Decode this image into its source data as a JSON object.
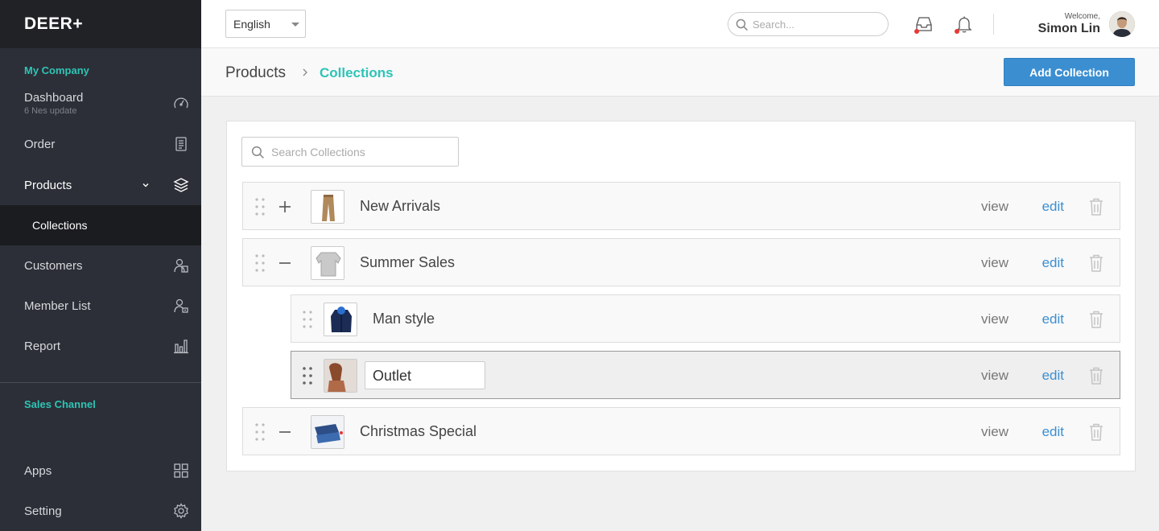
{
  "brand": {
    "logo": "DEER+"
  },
  "sidebar": {
    "section_company": "My Company",
    "dashboard": {
      "label": "Dashboard",
      "sub": "6 Nes update",
      "icon": "speedometer-icon"
    },
    "order": {
      "label": "Order",
      "icon": "document-icon"
    },
    "products": {
      "label": "Products",
      "icon": "box-icon"
    },
    "collections": {
      "label": "Collections"
    },
    "customers": {
      "label": "Customers",
      "icon": "users-icon"
    },
    "member_list": {
      "label": "Member List",
      "icon": "member-icon"
    },
    "report": {
      "label": "Report",
      "icon": "bar-chart-icon"
    },
    "section_sales": "Sales Channel",
    "apps": {
      "label": "Apps",
      "icon": "grid-icon"
    },
    "setting": {
      "label": "Setting",
      "icon": "gear-icon"
    }
  },
  "topbar": {
    "language": "English",
    "search_placeholder": "Search...",
    "welcome": "Welcome,",
    "user_name": "Simon Lin"
  },
  "header": {
    "crumb_root": "Products",
    "crumb_current": "Collections",
    "add_button": "Add Collection"
  },
  "collections": {
    "search_placeholder": "Search Collections",
    "view_label": "view",
    "edit_label": "edit",
    "rows": [
      {
        "title": "New Arrivals",
        "toggle": "plus"
      },
      {
        "title": "Summer Sales",
        "toggle": "minus"
      },
      {
        "title": "Man style"
      },
      {
        "title": "Outlet",
        "editing": true
      },
      {
        "title": "Christmas Special",
        "toggle": "minus"
      }
    ]
  },
  "colors": {
    "accent": "#2ec4b6",
    "primary": "#3b8fd1",
    "sidebar": "#2c2f37",
    "sidebar_dark": "#202226"
  }
}
